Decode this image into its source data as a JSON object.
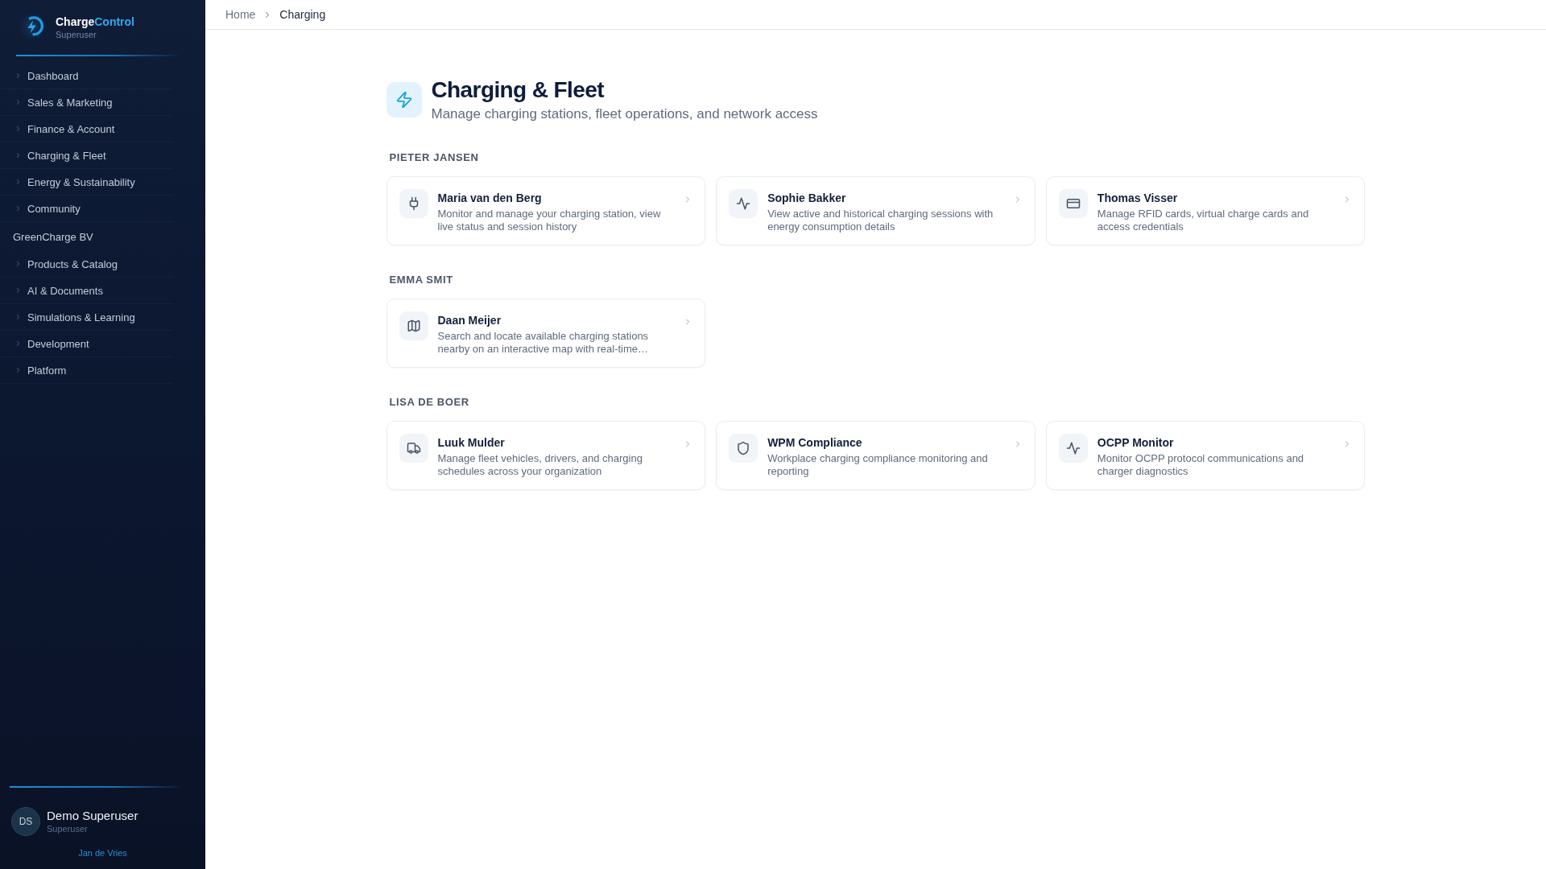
{
  "sidebar": {
    "brand": {
      "name": "Charge",
      "name_accent": "Control",
      "role": "Superuser"
    },
    "nav_sections": [
      {
        "items": [
          {
            "label": "Dashboard",
            "expanded": false
          },
          {
            "label": "Sales & Marketing",
            "expanded": false
          },
          {
            "label": "Finance & Account",
            "expanded": false
          },
          {
            "label": "Charging & Fleet",
            "expanded": false
          },
          {
            "label": "Energy & Sustainability",
            "expanded": false
          },
          {
            "label": "Community",
            "expanded": false
          }
        ]
      },
      {
        "heading": "GreenCharge BV",
        "items": [
          {
            "label": "Products & Catalog",
            "expanded": false
          },
          {
            "label": "AI & Documents",
            "expanded": false
          },
          {
            "label": "Simulations & Learning",
            "expanded": false
          },
          {
            "label": "Development",
            "expanded": false
          },
          {
            "label": "Platform",
            "expanded": false
          }
        ]
      }
    ],
    "user": {
      "initials": "DS",
      "name": "Demo Superuser",
      "role": "Superuser",
      "link": "Jan de Vries"
    }
  },
  "breadcrumb": [
    {
      "label": "Home",
      "current": false
    },
    {
      "label": "Charging",
      "current": true
    }
  ],
  "page_header": {
    "title": "Charging & Fleet",
    "subtitle": "Manage charging stations, fleet operations, and network access"
  },
  "sections": [
    {
      "title": "PIETER JANSEN",
      "cards": [
        {
          "kind": "station",
          "title": "Maria van den Berg",
          "description": "Monitor and manage your charging station, view live status and session history"
        },
        {
          "kind": "sessions",
          "title": "Sophie Bakker",
          "description": "View active and historical charging sessions with energy consumption details"
        },
        {
          "kind": "cards",
          "title": "Thomas Visser",
          "description": "Manage RFID cards, virtual charge cards and access credentials"
        }
      ]
    },
    {
      "title": "EMMA SMIT",
      "cards": [
        {
          "kind": "map",
          "title": "Daan Meijer",
          "description": "Search and locate available charging stations nearby on an interactive map with real-time…"
        }
      ]
    },
    {
      "title": "LISA DE BOER",
      "cards": [
        {
          "kind": "fleet",
          "title": "Luuk Mulder",
          "description": "Manage fleet vehicles, drivers, and charging schedules across your organization"
        },
        {
          "kind": "compliance",
          "title": "WPM Compliance",
          "description": "Workplace charging compliance monitoring and reporting"
        },
        {
          "kind": "monitor",
          "title": "OCPP Monitor",
          "description": "Monitor OCPP protocol communications and charger diagnostics"
        }
      ]
    }
  ]
}
